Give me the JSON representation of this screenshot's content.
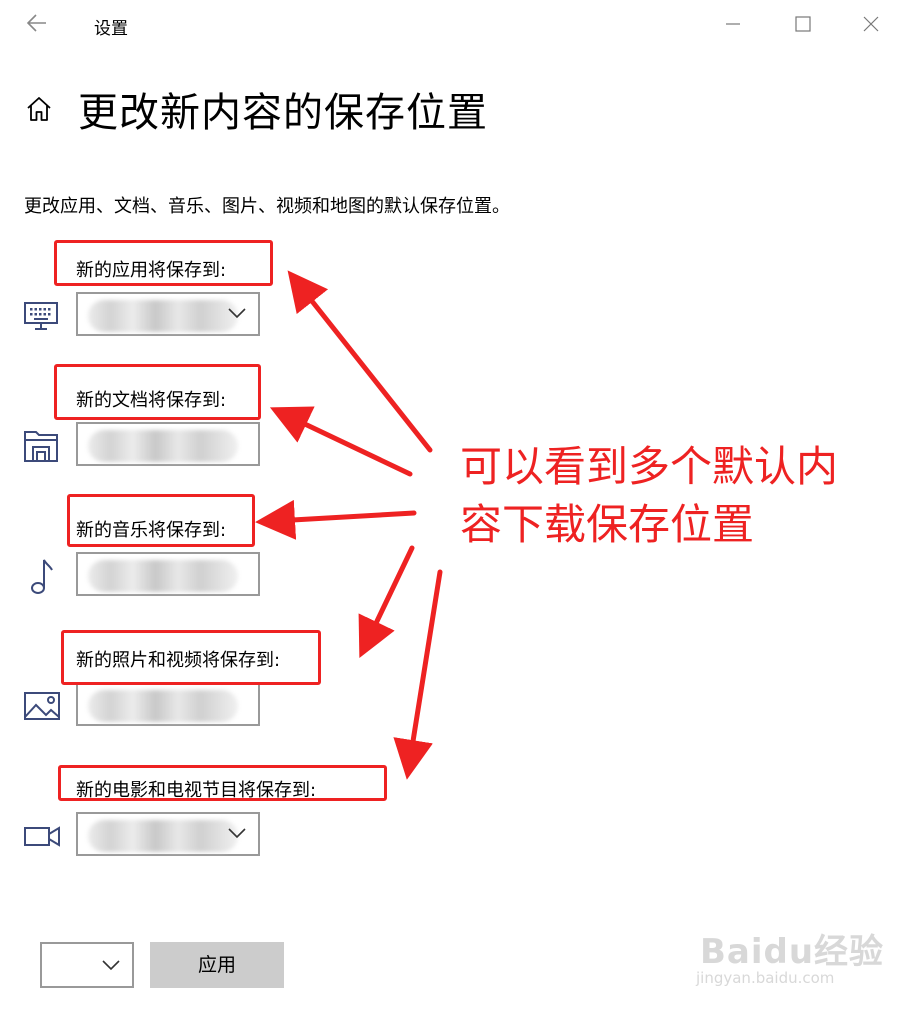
{
  "window": {
    "title": "设置"
  },
  "page": {
    "title": "更改新内容的保存位置",
    "description": "更改应用、文档、音乐、图片、视频和地图的默认保存位置。"
  },
  "settings": [
    {
      "label": "新的应用将保存到:",
      "icon": "keyboard-monitor-icon",
      "has_dropdown": true
    },
    {
      "label": "新的文档将保存到:",
      "icon": "documents-folder-icon",
      "has_dropdown": false
    },
    {
      "label": "新的音乐将保存到:",
      "icon": "music-note-icon",
      "has_dropdown": false
    },
    {
      "label": "新的照片和视频将保存到:",
      "icon": "picture-icon",
      "has_dropdown": false
    },
    {
      "label": "新的电影和电视节目将保存到:",
      "icon": "video-camera-icon",
      "has_dropdown": true
    }
  ],
  "annotation": {
    "text_line1": "可以看到多个默认内",
    "text_line2": "容下载保存位置",
    "color": "#ee2222"
  },
  "footer": {
    "apply_label": "应用"
  },
  "watermark": {
    "brand": "Baidu经验",
    "url": "jingyan.baidu.com"
  },
  "colors": {
    "border": "#999999",
    "button_bg": "#cccccc",
    "accent_icon": "#3c4a7a"
  }
}
